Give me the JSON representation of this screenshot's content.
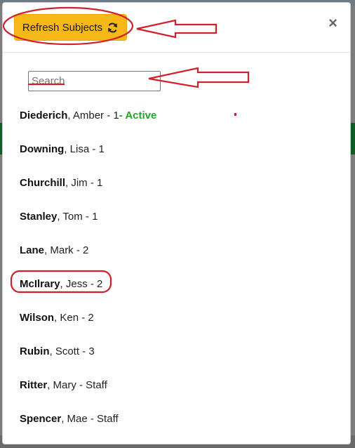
{
  "modal": {
    "refresh_label": "Refresh Subjects",
    "close_glyph": "×",
    "refresh_icon": "sync-icon",
    "close_icon": "close-icon"
  },
  "search": {
    "placeholder": "Search",
    "value": ""
  },
  "subjects": [
    {
      "last": "Diederich",
      "rest": ", Amber - 1",
      "status": " - Active"
    },
    {
      "last": "Downing",
      "rest": ", Lisa - 1",
      "status": ""
    },
    {
      "last": "Churchill",
      "rest": ", Jim - 1",
      "status": ""
    },
    {
      "last": "Stanley",
      "rest": ", Tom - 1",
      "status": ""
    },
    {
      "last": "Lane",
      "rest": ", Mark - 2",
      "status": ""
    },
    {
      "last": "McIlrary",
      "rest": ", Jess - 2",
      "status": ""
    },
    {
      "last": "Wilson",
      "rest": ", Ken - 2",
      "status": ""
    },
    {
      "last": "Rubin",
      "rest": ", Scott - 3",
      "status": ""
    },
    {
      "last": "Ritter",
      "rest": ", Mary - Staff",
      "status": ""
    },
    {
      "last": "Spencer",
      "rest": ", Mae - Staff",
      "status": ""
    }
  ],
  "colors": {
    "button": "#f8b918",
    "active": "#23a523",
    "annotation": "#d0202a"
  }
}
